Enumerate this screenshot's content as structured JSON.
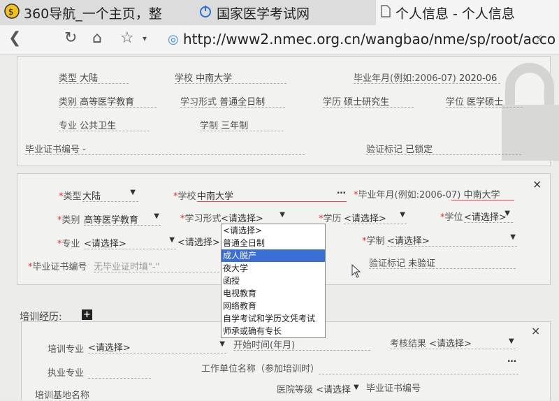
{
  "tabs": [
    {
      "icon": "360-icon",
      "title": "360导航_一个主页，整"
    },
    {
      "icon": "power-icon",
      "title": "国家医学考试网"
    },
    {
      "icon": "page-icon",
      "title": "个人信息 - 个人信息"
    }
  ],
  "address": {
    "url": "http://www2.nmec.org.cn/wangbao/nme/sp/root/acco"
  },
  "info": {
    "type_label": "类型",
    "type_value": "大陆",
    "school_label": "学校",
    "school_value": "中南大学",
    "grad_label": "毕业年月(例如:2006-07)",
    "grad_value": "2020-06",
    "category_label": "类别",
    "category_value": "高等医学教育",
    "studyform_label": "学习形式",
    "studyform_value": "普通全日制",
    "edu_label": "学历",
    "edu_value": "硕士研究生",
    "degree_label": "学位",
    "degree_value": "医学硕士",
    "major_label": "专业",
    "major_value": "公共卫生",
    "duration_label": "学制",
    "duration_value": "三年制",
    "certno_label": "毕业证书编号",
    "certno_value": "-",
    "verify_label": "验证标记",
    "verify_value": "已锁定"
  },
  "form": {
    "type_label": "类型",
    "type_value": "大陆",
    "school_label": "学校",
    "school_value": "中南大学",
    "grad_label": "毕业年月(例如:2006-07)",
    "grad_value": "中南大学",
    "category_label": "类别",
    "category_value": "高等医学教育",
    "studyform_label": "学习形式",
    "studyform_value": "<请选择>",
    "edu_label": "学历",
    "edu_value": "<请选择>",
    "degree_label": "学位",
    "degree_value": "<请选择>",
    "major_label": "专业",
    "major_value": "<请选择>",
    "major2_value": "<请选择>",
    "duration_label": "学制",
    "duration_value": "<请选择>",
    "certno_label": "毕业证书编号",
    "certno_placeholder": "无毕业证时填\"-\"",
    "verify_label": "验证标记",
    "verify_value": "未验证",
    "ellipsis": "…",
    "close": "×"
  },
  "dropdown": {
    "options": [
      "<请选择>",
      "普通全日制",
      "成人脱产",
      "夜大学",
      "函授",
      "电视教育",
      "网络教育",
      "自学考试和学历文凭考试",
      "师承或确有专长"
    ],
    "highlighted": 2
  },
  "training": {
    "title": "培训经历:",
    "add": "+",
    "close": "×",
    "major_label": "培训专业",
    "major_value": "<请选择>",
    "start_label": "开始时间(年月)",
    "result_label": "考核结果",
    "result_value": "<请选择>",
    "practice_label": "执业专业",
    "employer_label": "工作单位名称（参加培训时）",
    "ellipsis": "…",
    "base_label": "培训基地名称",
    "hospital_label": "医院等级",
    "hospital_value": "<请选择",
    "cert_label": "毕业证书编号"
  }
}
